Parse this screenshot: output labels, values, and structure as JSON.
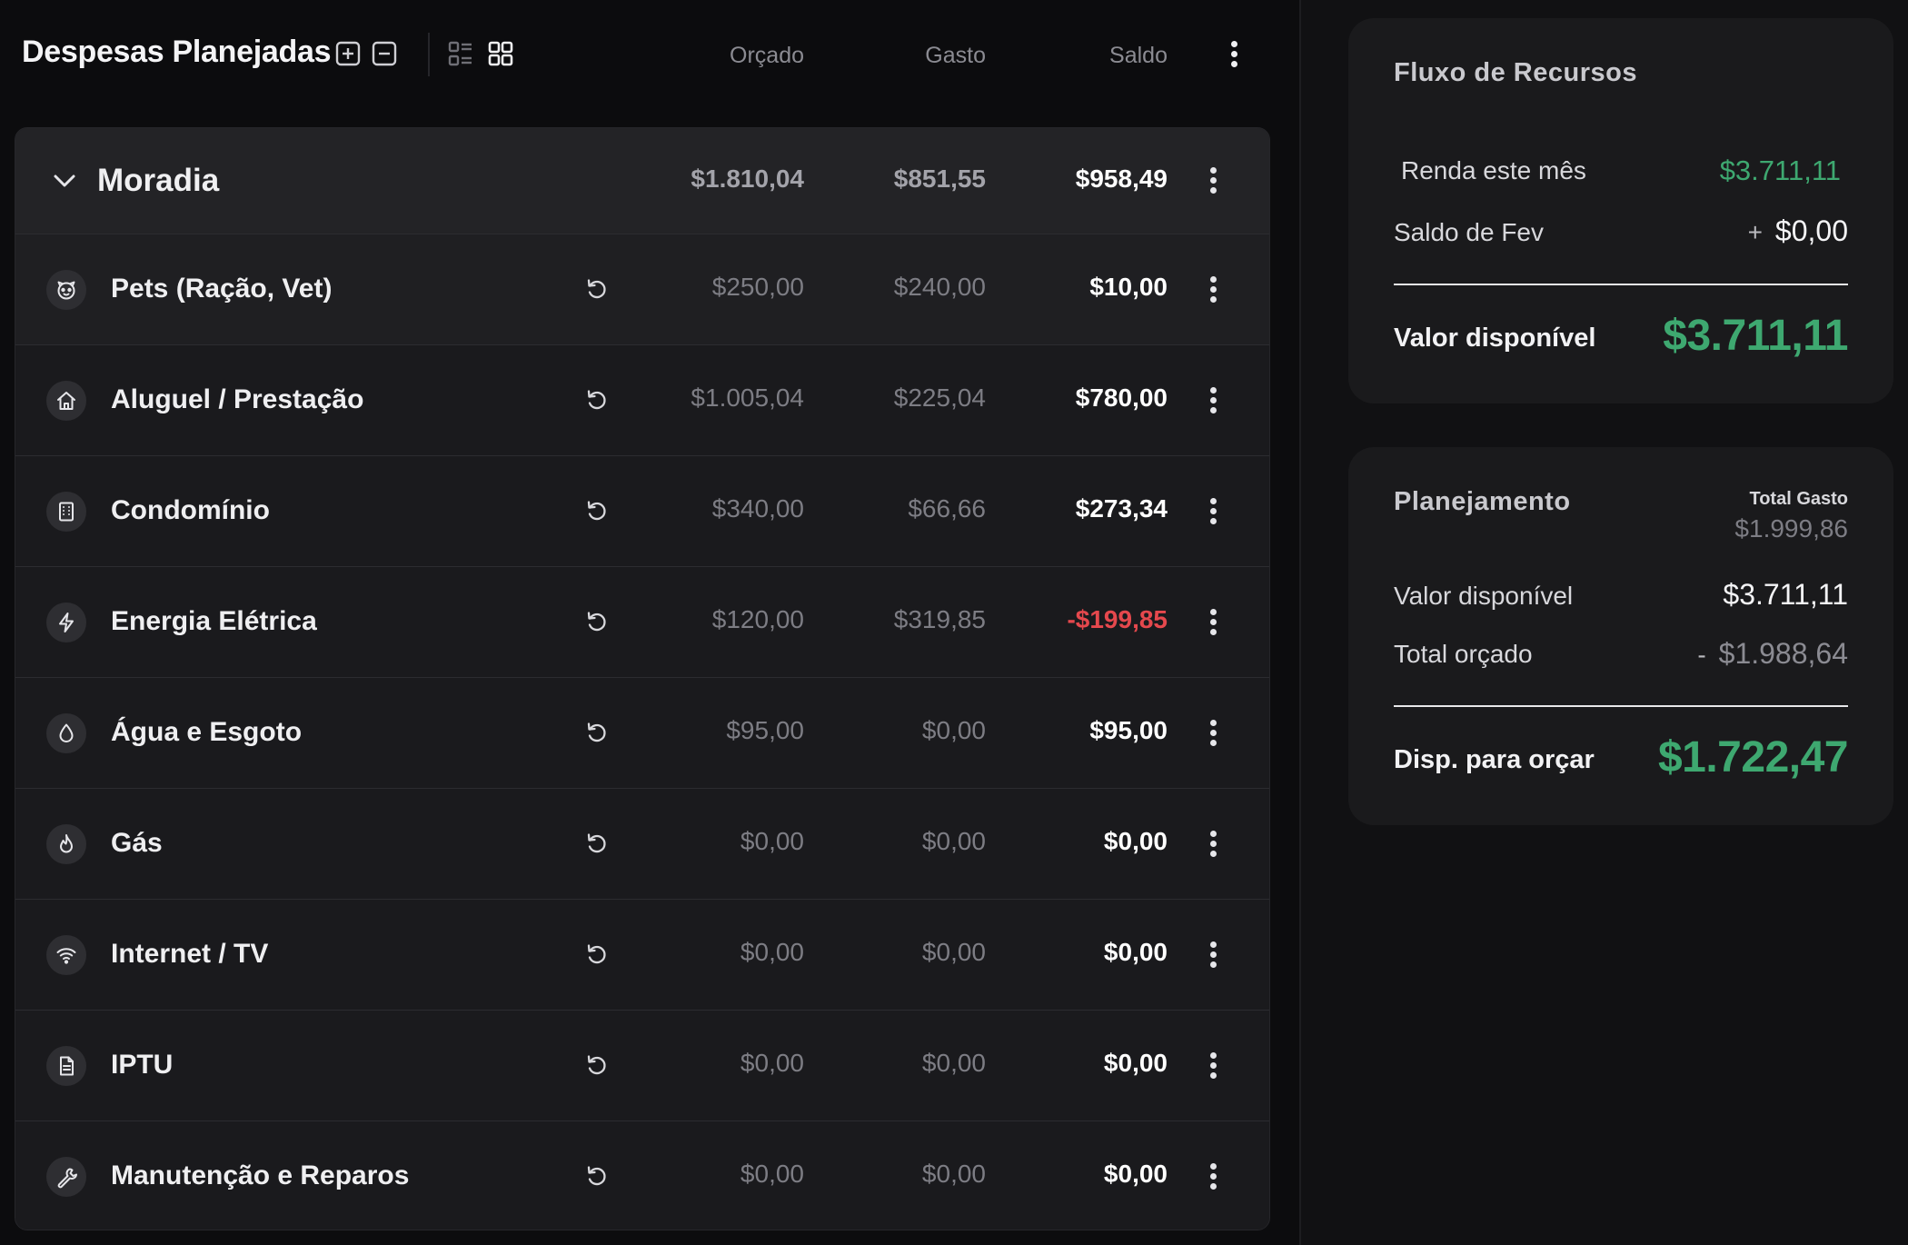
{
  "header": {
    "title": "Despesas Planejadas",
    "columns": {
      "budget": "Orçado",
      "spent": "Gasto",
      "balance": "Saldo"
    }
  },
  "group": {
    "name": "Moradia",
    "budget": "$1.810,04",
    "spent": "$851,55",
    "balance": "$958,49"
  },
  "categories": [
    {
      "name": "Pets (Ração, Vet)",
      "icon": "paw-icon",
      "budget": "$250,00",
      "spent": "$240,00",
      "balance": "$10,00",
      "negative": false
    },
    {
      "name": "Aluguel / Prestação",
      "icon": "home-icon",
      "budget": "$1.005,04",
      "spent": "$225,04",
      "balance": "$780,00",
      "negative": false
    },
    {
      "name": "Condomínio",
      "icon": "building-icon",
      "budget": "$340,00",
      "spent": "$66,66",
      "balance": "$273,34",
      "negative": false
    },
    {
      "name": "Energia Elétrica",
      "icon": "lightning-icon",
      "budget": "$120,00",
      "spent": "$319,85",
      "balance": "-$199,85",
      "negative": true
    },
    {
      "name": "Água e Esgoto",
      "icon": "droplet-icon",
      "budget": "$95,00",
      "spent": "$0,00",
      "balance": "$95,00",
      "negative": false
    },
    {
      "name": "Gás",
      "icon": "flame-icon",
      "budget": "$0,00",
      "spent": "$0,00",
      "balance": "$0,00",
      "negative": false
    },
    {
      "name": "Internet / TV",
      "icon": "wifi-icon",
      "budget": "$0,00",
      "spent": "$0,00",
      "balance": "$0,00",
      "negative": false
    },
    {
      "name": "IPTU",
      "icon": "document-icon",
      "budget": "$0,00",
      "spent": "$0,00",
      "balance": "$0,00",
      "negative": false
    },
    {
      "name": "Manutenção e Reparos",
      "icon": "wrench-icon",
      "budget": "$0,00",
      "spent": "$0,00",
      "balance": "$0,00",
      "negative": false
    }
  ],
  "flow": {
    "title": "Fluxo de Recursos",
    "income_label": "Renda este mês",
    "income_value": "$3.711,11",
    "prev_label": "Saldo de Fev",
    "prev_prefix": "+",
    "prev_value": "$0,00",
    "available_label": "Valor disponível",
    "available_value": "$3.711,11"
  },
  "planning": {
    "title": "Planejamento",
    "total_spent_label": "Total Gasto",
    "total_spent_value": "$1.999,86",
    "available_label": "Valor disponível",
    "available_value": "$3.711,11",
    "budgeted_label": "Total orçado",
    "budgeted_prefix": "-",
    "budgeted_value": "$1.988,64",
    "to_budget_label": "Disp. para orçar",
    "to_budget_value": "$1.722,47"
  },
  "colors": {
    "positive": "#3ea870",
    "negative": "#e5484d",
    "background": "#0c0c0e",
    "card": "#1a1a1c"
  }
}
